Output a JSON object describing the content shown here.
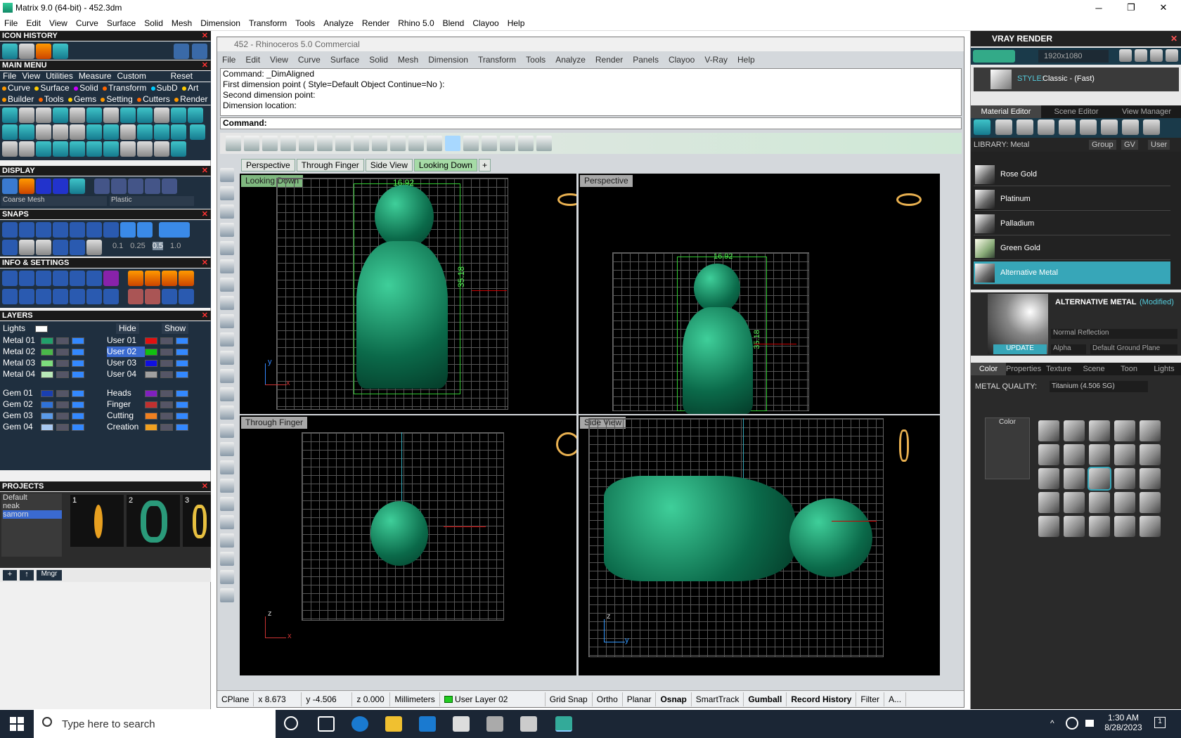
{
  "window": {
    "title": "Matrix 9.0 (64-bit) - 452.3dm",
    "controls": [
      "─",
      "❐",
      "✕"
    ]
  },
  "menubar": [
    "File",
    "Edit",
    "View",
    "Curve",
    "Surface",
    "Solid",
    "Mesh",
    "Dimension",
    "Transform",
    "Tools",
    "Analyze",
    "Render",
    "Rhino 5.0",
    "Blend",
    "Clayoo",
    "Help"
  ],
  "left": {
    "icon_history": "ICON HISTORY",
    "main_menu": "MAIN MENU",
    "main_menu_items": [
      "File",
      "View",
      "Utilities",
      "Measure",
      "Custom"
    ],
    "reset": "Reset",
    "cats1": [
      "Curve",
      "Surface",
      "Solid",
      "Transform",
      "SubD",
      "Art"
    ],
    "cats2": [
      "Builder",
      "Tools",
      "Gems",
      "Setting",
      "Cutters",
      "Render"
    ],
    "display": "DISPLAY",
    "display_mesh": "Coarse Mesh",
    "display_mat": "Plastic",
    "snaps": "SNAPS",
    "snap_vals": [
      "0.1",
      "0.25",
      "0.5",
      "1.0"
    ],
    "info": "INFO & SETTINGS",
    "layers": "LAYERS",
    "lights": "Lights",
    "hide": "Hide",
    "show": "Show",
    "layers_left": [
      {
        "name": "Metal 01",
        "color": "#21a06b"
      },
      {
        "name": "Metal 02",
        "color": "#4ab84a"
      },
      {
        "name": "Metal 03",
        "color": "#7ddc7d"
      },
      {
        "name": "Metal 04",
        "color": "#b8e8b8"
      },
      {
        "name": "Gem 01",
        "color": "#1a3fb0"
      },
      {
        "name": "Gem 02",
        "color": "#2f72d8"
      },
      {
        "name": "Gem 03",
        "color": "#5a9ae8"
      },
      {
        "name": "Gem 04",
        "color": "#a8c8f0"
      }
    ],
    "layers_right": [
      {
        "name": "User 01",
        "color": "#e01010"
      },
      {
        "name": "User 02",
        "color": "#10c010"
      },
      {
        "name": "User 03",
        "color": "#1010e0"
      },
      {
        "name": "User 04",
        "color": "#a0a0a0"
      },
      {
        "name": "Heads",
        "color": "#8020c0"
      },
      {
        "name": "Finger",
        "color": "#c03030"
      },
      {
        "name": "Cutting",
        "color": "#f08020"
      },
      {
        "name": "Creation",
        "color": "#f0a020"
      }
    ],
    "projects": "PROJECTS",
    "project_list": [
      "Default",
      "neak",
      "samorn"
    ],
    "thumbs": [
      "1",
      "2",
      "3"
    ],
    "mngr": "Mngr"
  },
  "rhino": {
    "title": "452 - Rhinoceros 5.0 Commercial",
    "menu": [
      "File",
      "Edit",
      "View",
      "Curve",
      "Surface",
      "Solid",
      "Mesh",
      "Dimension",
      "Transform",
      "Tools",
      "Analyze",
      "Render",
      "Panels",
      "Clayoo",
      "V-Ray",
      "Help"
    ],
    "history": [
      "Command: _DimAligned",
      "First dimension point ( Style=Default  Object  Continue=No ):",
      "Second dimension point:",
      "Dimension location:"
    ],
    "prompt": "Command:",
    "tabs": [
      "Perspective",
      "Through Finger",
      "Side View",
      "Looking Down"
    ],
    "viewports": {
      "tl": "Looking Down",
      "tr": "Perspective",
      "bl": "Through Finger",
      "br": "Side View"
    },
    "dims": {
      "width": "16.92",
      "height": "35.18"
    },
    "axis": {
      "x": "x",
      "y": "y",
      "z": "z"
    },
    "status": [
      "CPlane",
      "x 8.673",
      "y -4.506",
      "z 0.000",
      "Millimeters",
      "User Layer 02",
      "Grid Snap",
      "Ortho",
      "Planar",
      "Osnap",
      "SmartTrack",
      "Gumball",
      "Record History",
      "Filter",
      "A..."
    ]
  },
  "vray": {
    "title": "VRAY RENDER",
    "resolution": "1920x1080",
    "style_label": "STYLE:",
    "style": "Classic - (Fast)",
    "tabs": [
      "Material Editor",
      "Scene Editor",
      "View Manager"
    ],
    "library": "LIBRARY: Metal",
    "lib_opts": [
      "Group",
      "GV",
      "User"
    ],
    "materials": [
      "Rose Gold",
      "Platinum",
      "Palladium",
      "Green Gold",
      "Alternative Metal"
    ],
    "selected_name": "ALTERNATIVE METAL",
    "modified": "(Modified)",
    "reflection": "Normal Reflection",
    "update": "UPDATE",
    "alpha": "Alpha",
    "ground": "Default Ground Plane",
    "subtabs": [
      "Color",
      "Properties",
      "Texture",
      "Scene",
      "Toon",
      "Lights"
    ],
    "metal_quality_label": "METAL QUALITY:",
    "metal_quality": "Titanium     (4.506 SG)",
    "color_label": "Color"
  },
  "taskbar": {
    "search": "Type here to search",
    "time": "1:30 AM",
    "date": "8/28/2023",
    "notif": "1"
  }
}
